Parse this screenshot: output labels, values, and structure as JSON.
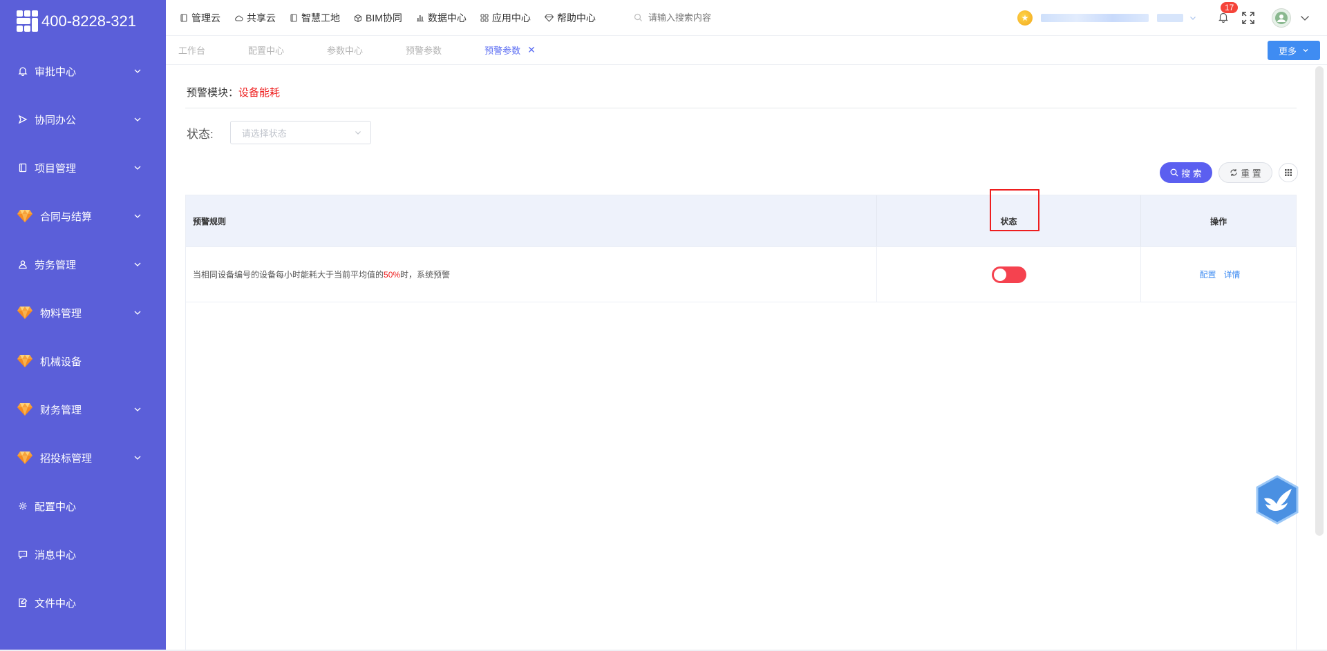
{
  "sidebar": {
    "phone": "400-8228-321",
    "items": [
      {
        "label": "审批中心",
        "icon": "bell-icon",
        "expandable": true
      },
      {
        "label": "协同办公",
        "icon": "send-icon",
        "expandable": true
      },
      {
        "label": "项目管理",
        "icon": "book-icon",
        "expandable": true
      },
      {
        "label": "合同与结算",
        "icon": "gem-icon",
        "expandable": true
      },
      {
        "label": "劳务管理",
        "icon": "user-icon",
        "expandable": true
      },
      {
        "label": "物料管理",
        "icon": "gem-icon",
        "expandable": true
      },
      {
        "label": "机械设备",
        "icon": "gem-icon",
        "expandable": false
      },
      {
        "label": "财务管理",
        "icon": "gem-icon",
        "expandable": true
      },
      {
        "label": "招投标管理",
        "icon": "gem-icon",
        "expandable": true
      },
      {
        "label": "配置中心",
        "icon": "gear-icon",
        "expandable": false
      },
      {
        "label": "消息中心",
        "icon": "message-icon",
        "expandable": false
      },
      {
        "label": "文件中心",
        "icon": "file-edit-icon",
        "expandable": false
      }
    ]
  },
  "topnav": {
    "items": [
      {
        "label": "管理云",
        "icon": "doc-icon"
      },
      {
        "label": "共享云",
        "icon": "cloud-icon"
      },
      {
        "label": "智慧工地",
        "icon": "doc-icon"
      },
      {
        "label": "BIM协同",
        "icon": "box-icon"
      },
      {
        "label": "数据中心",
        "icon": "bar-chart-icon"
      },
      {
        "label": "应用中心",
        "icon": "apps-icon"
      },
      {
        "label": "帮助中心",
        "icon": "diamond-icon"
      }
    ],
    "search_placeholder": "请输入搜索内容",
    "notification_count": "17"
  },
  "tabs": [
    {
      "label": "工作台",
      "active": false
    },
    {
      "label": "配置中心",
      "active": false
    },
    {
      "label": "参数中心",
      "active": false
    },
    {
      "label": "预警参数",
      "active": false
    },
    {
      "label": "预警参数",
      "active": true,
      "closable": true
    }
  ],
  "more_label": "更多",
  "module": {
    "label": "预警模块：",
    "value": "设备能耗"
  },
  "filter": {
    "label": "状态:",
    "placeholder": "请选择状态"
  },
  "buttons": {
    "search": "搜 索",
    "reset": "重 置"
  },
  "table": {
    "headers": [
      "预警规则",
      "状态",
      "操作"
    ],
    "rows": [
      {
        "rule_prefix": "当相同设备编号的设备每小时能耗大于当前平均值的",
        "rule_pct": "50%",
        "rule_suffix": "时，系统预警",
        "status_on": false,
        "actions": [
          "配置",
          "详情"
        ]
      }
    ]
  },
  "colors": {
    "sidebar": "#5b5fd9",
    "primary": "#5b5ff0",
    "link": "#3f8cf2",
    "danger": "#ee1e1e",
    "switch_off": "#f5424f"
  }
}
